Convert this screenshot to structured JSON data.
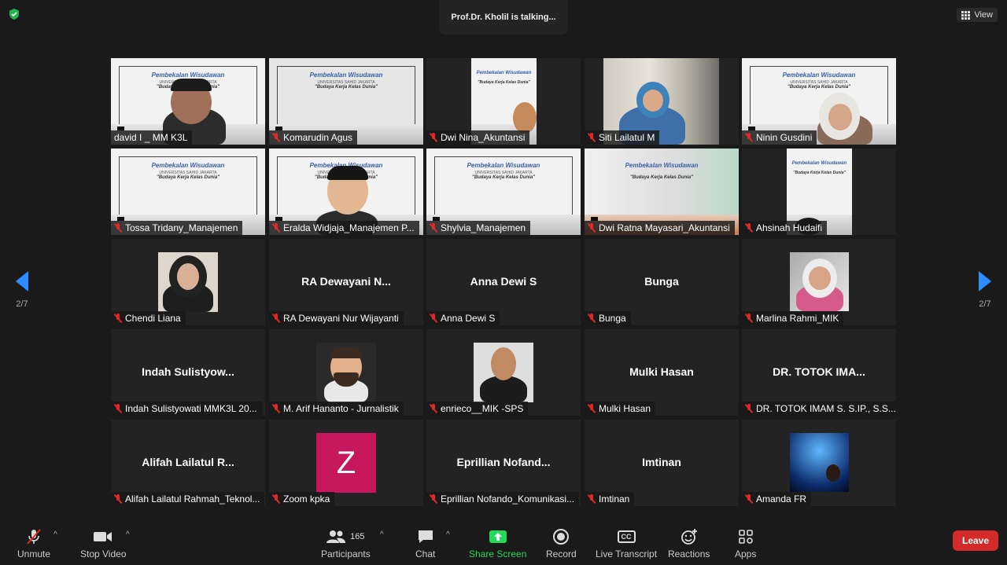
{
  "header": {
    "talking": "Prof.Dr. Kholil is talking...",
    "view_label": "View"
  },
  "pager": {
    "left": "2/7",
    "right": "2/7"
  },
  "slide": {
    "title": "Pembekalan Wisudawan",
    "subtitle": "UNIVERSITAS SAHID JAKARTA",
    "tagline": "\"Budaya Kerja Kelas Dunia\"",
    "date": "Selasa, 24 Mei 2022"
  },
  "tiles": [
    {
      "name": "david I _ MM K3L",
      "muted": false
    },
    {
      "name": "Komarudin Agus",
      "muted": true
    },
    {
      "name": "Dwi Nina_Akuntansi",
      "muted": true
    },
    {
      "name": "Siti Lailatul M",
      "muted": true
    },
    {
      "name": "Ninin Gusdini",
      "muted": true
    },
    {
      "name": "Tossa Tridany_Manajemen",
      "muted": true
    },
    {
      "name": "Eralda Widjaja_Manajemen P...",
      "muted": true
    },
    {
      "name": "Shylvia_Manajemen",
      "muted": true
    },
    {
      "name": "Dwi Ratna Mayasari_Akuntansi",
      "muted": true
    },
    {
      "name": "Ahsinah Hudaifi",
      "muted": true
    },
    {
      "name": "Chendi Liana",
      "muted": true
    },
    {
      "name": "RA Dewayani Nur Wijayanti",
      "display": "RA  Dewayani  N...",
      "muted": true
    },
    {
      "name": "Anna Dewi S",
      "display": "Anna  Dewi  S",
      "muted": true
    },
    {
      "name": "Bunga",
      "display": "Bunga",
      "muted": true
    },
    {
      "name": "Marlina Rahmi_MIK",
      "muted": true
    },
    {
      "name": "Indah Sulistyowati MMK3L 20...",
      "display": "Indah  Sulistyow...",
      "muted": true
    },
    {
      "name": "M. Arif Hananto - Jurnalistik",
      "muted": true
    },
    {
      "name": "enrieco__MIK -SPS",
      "muted": true
    },
    {
      "name": "Mulki Hasan",
      "display": "Mulki  Hasan",
      "muted": true
    },
    {
      "name": "DR. TOTOK IMAM S. S.IP., S.S...",
      "display": "DR.  TOTOK  IMA...",
      "muted": true
    },
    {
      "name": "Alifah Lailatul Rahmah_Teknol...",
      "display": "Alifah  Lailatul  R...",
      "muted": true
    },
    {
      "name": "Zoom kpka",
      "avatar_letter": "Z",
      "muted": true
    },
    {
      "name": "Eprillian Nofando_Komunikasi...",
      "display": "Eprillian  Nofand...",
      "muted": true
    },
    {
      "name": "Imtinan",
      "display": "Imtinan",
      "muted": true
    },
    {
      "name": "Amanda FR",
      "muted": true
    }
  ],
  "toolbar": {
    "unmute": "Unmute",
    "stop_video": "Stop Video",
    "participants": "Participants",
    "participants_count": "165",
    "chat": "Chat",
    "share_screen": "Share Screen",
    "record": "Record",
    "live_transcript": "Live Transcript",
    "cc": "CC",
    "reactions": "Reactions",
    "apps": "Apps",
    "leave": "Leave"
  },
  "colors": {
    "accent": "#2d8cff",
    "share": "#23d959",
    "leave": "#d32a2a",
    "muted_mic": "#e02828",
    "zoom_avatar": "#c6175f"
  }
}
